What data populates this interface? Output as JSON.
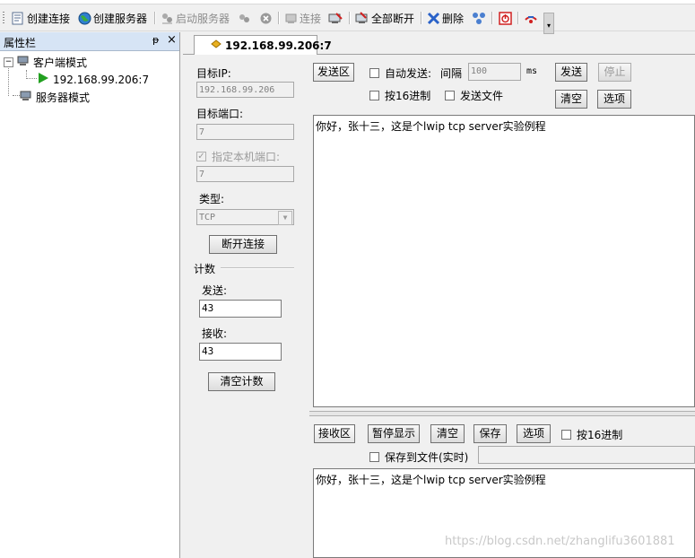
{
  "toolbar": {
    "create_connection": "创建连接",
    "create_server": "创建服务器",
    "start_server": "启动服务器",
    "connect": "连接",
    "disconnect_all": "全部断开",
    "delete": "删除"
  },
  "panel": {
    "title": "属性栏",
    "pin": "ᵽ",
    "close": "×",
    "client_mode": "客户端模式",
    "connection": "192.168.99.206:7",
    "server_mode": "服务器模式"
  },
  "tab": {
    "label": "192.168.99.206:7"
  },
  "settings": {
    "target_ip_label": "目标IP:",
    "target_ip": "192.168.99.206",
    "target_port_label": "目标端口:",
    "target_port": "7",
    "local_port_label": "指定本机端口:",
    "local_port": "7",
    "type_label": "类型:",
    "type_value": "TCP",
    "disconnect_button": "断开连接",
    "count_label": "计数",
    "send_label": "发送:",
    "send_count": "43",
    "recv_label": "接收:",
    "recv_count": "43",
    "clear_count_button": "清空计数"
  },
  "send_area": {
    "tab_label": "发送区",
    "auto_send": "自动发送:",
    "interval_label": "间隔",
    "interval_value": "100",
    "ms": "ms",
    "send_button": "发送",
    "stop_button": "停止",
    "hex": "按16进制",
    "send_file": "发送文件",
    "clear_button": "清空",
    "options_button": "选项",
    "content": "你好，张十三，这是个lwip tcp server实验例程"
  },
  "recv_area": {
    "tab_label": "接收区",
    "pause_button": "暂停显示",
    "clear_button": "清空",
    "save_button": "保存",
    "options_button": "选项",
    "hex": "按16进制",
    "save_to_file": "保存到文件(实时)",
    "content": "你好，张十三，这是个lwip tcp server实验例程"
  },
  "watermark": "https://blog.csdn.net/zhanglifu3601881"
}
